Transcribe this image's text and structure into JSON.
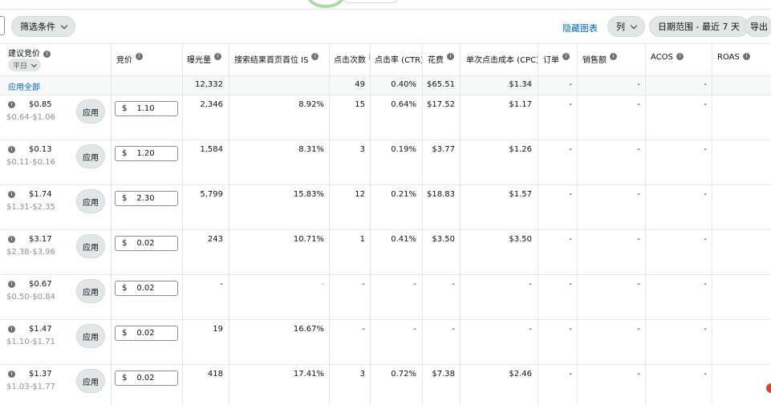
{
  "toolbar": {
    "filter_label": "筛选条件",
    "hide_chart_label": "隐藏图表",
    "columns_label": "列",
    "date_range_label": "日期范围 - 最近 7 天",
    "export_label": "导出"
  },
  "table": {
    "headers": {
      "suggested_bid": "建议竞价",
      "suggested_bid_mode": "平日",
      "bid": "竞价",
      "impressions": "曝光量",
      "top_of_search_is": "搜索结果首页首位 IS",
      "clicks": "点击次数",
      "ctr": "点击率 (CTR)",
      "spend": "花费",
      "cpc": "单次点击成本 (CPC)",
      "orders": "订单",
      "sales": "销售额",
      "acos": "ACOS",
      "roas": "ROAS"
    },
    "summary": {
      "apply_all": "应用全部",
      "impressions": "12,332",
      "clicks": "49",
      "ctr": "0.40%",
      "spend": "$65.51",
      "cpc": "$1.34",
      "orders": "-",
      "sales": "-",
      "acos": "-"
    },
    "apply_label": "应用",
    "currency": "$",
    "rows": [
      {
        "sug": "$0.85",
        "range": "$0.64-$1.06",
        "bid": "1.10",
        "imp": "2,346",
        "is": "8.92%",
        "clicks": "15",
        "ctr": "0.64%",
        "spend": "$17.52",
        "cpc": "$1.17",
        "orders": "-",
        "sales": "-",
        "acos": "-"
      },
      {
        "sug": "$0.13",
        "range": "$0.11-$0.16",
        "bid": "1.20",
        "imp": "1,584",
        "is": "8.31%",
        "clicks": "3",
        "ctr": "0.19%",
        "spend": "$3.77",
        "cpc": "$1.26",
        "orders": "-",
        "sales": "-",
        "acos": "-"
      },
      {
        "sug": "$1.74",
        "range": "$1.31-$2.35",
        "bid": "2.30",
        "imp": "5,799",
        "is": "15.83%",
        "clicks": "12",
        "ctr": "0.21%",
        "spend": "$18.83",
        "cpc": "$1.57",
        "orders": "-",
        "sales": "-",
        "acos": "-"
      },
      {
        "sug": "$3.17",
        "range": "$2.38-$3.96",
        "bid": "0.02",
        "imp": "243",
        "is": "10.71%",
        "clicks": "1",
        "ctr": "0.41%",
        "spend": "$3.50",
        "cpc": "$3.50",
        "orders": "-",
        "sales": "-",
        "acos": "-"
      },
      {
        "sug": "$0.67",
        "range": "$0.50-$0.84",
        "bid": "0.02",
        "imp": "-",
        "is": "-",
        "clicks": "-",
        "ctr": "-",
        "spend": "-",
        "cpc": "-",
        "orders": "-",
        "sales": "-",
        "acos": "-"
      },
      {
        "sug": "$1.47",
        "range": "$1.10-$1.71",
        "bid": "0.02",
        "imp": "19",
        "is": "16.67%",
        "clicks": "-",
        "ctr": "-",
        "spend": "-",
        "cpc": "-",
        "orders": "-",
        "sales": "-",
        "acos": "-"
      },
      {
        "sug": "$1.37",
        "range": "$1.03-$1.77",
        "bid": "0.02",
        "imp": "418",
        "is": "17.41%",
        "clicks": "3",
        "ctr": "0.72%",
        "spend": "$7.38",
        "cpc": "$2.46",
        "orders": "-",
        "sales": "-",
        "acos": "-"
      }
    ]
  }
}
